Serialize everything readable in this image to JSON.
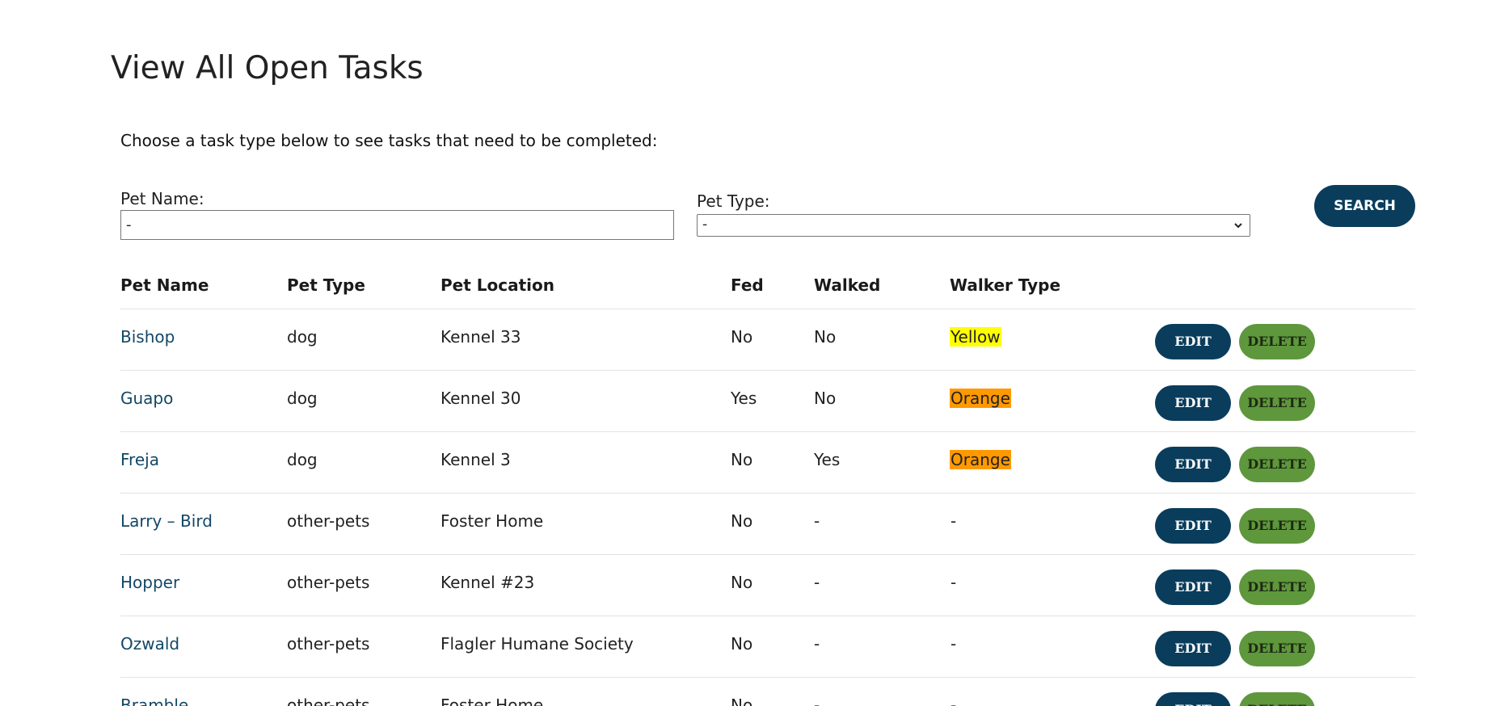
{
  "page": {
    "title": "View All Open Tasks",
    "intro": "Choose a task type below to see tasks that need to be completed:"
  },
  "filters": {
    "pet_name_label": "Pet Name:",
    "pet_name_value": "-",
    "pet_type_label": "Pet Type:",
    "pet_type_selected": "-",
    "search_label": "SEARCH"
  },
  "table": {
    "headers": {
      "pet_name": "Pet Name",
      "pet_type": "Pet Type",
      "pet_location": "Pet Location",
      "fed": "Fed",
      "walked": "Walked",
      "walker_type": "Walker Type"
    },
    "edit_label": "EDIT",
    "delete_label": "DELETE",
    "rows": [
      {
        "name": "Bishop",
        "type": "dog",
        "location": "Kennel 33",
        "fed": "No",
        "walked": "No",
        "walker": "Yellow",
        "walker_color": "#ffff00"
      },
      {
        "name": "Guapo",
        "type": "dog",
        "location": "Kennel 30",
        "fed": "Yes",
        "walked": "No",
        "walker": "Orange",
        "walker_color": "#ff9900"
      },
      {
        "name": "Freja",
        "type": "dog",
        "location": "Kennel 3",
        "fed": "No",
        "walked": "Yes",
        "walker": "Orange",
        "walker_color": "#ff9900"
      },
      {
        "name": "Larry – Bird",
        "type": "other-pets",
        "location": "Foster Home",
        "fed": "No",
        "walked": "-",
        "walker": "-",
        "walker_color": ""
      },
      {
        "name": "Hopper",
        "type": "other-pets",
        "location": "Kennel #23",
        "fed": "No",
        "walked": "-",
        "walker": "-",
        "walker_color": ""
      },
      {
        "name": "Ozwald",
        "type": "other-pets",
        "location": "Flagler Humane Society",
        "fed": "No",
        "walked": "-",
        "walker": "-",
        "walker_color": ""
      },
      {
        "name": "Bramble",
        "type": "other-pets",
        "location": "Foster Home",
        "fed": "No",
        "walked": "-",
        "walker": "-",
        "walker_color": ""
      }
    ]
  },
  "colors": {
    "primary": "#0a3d5c",
    "delete": "#5e973c",
    "link": "#134766"
  }
}
